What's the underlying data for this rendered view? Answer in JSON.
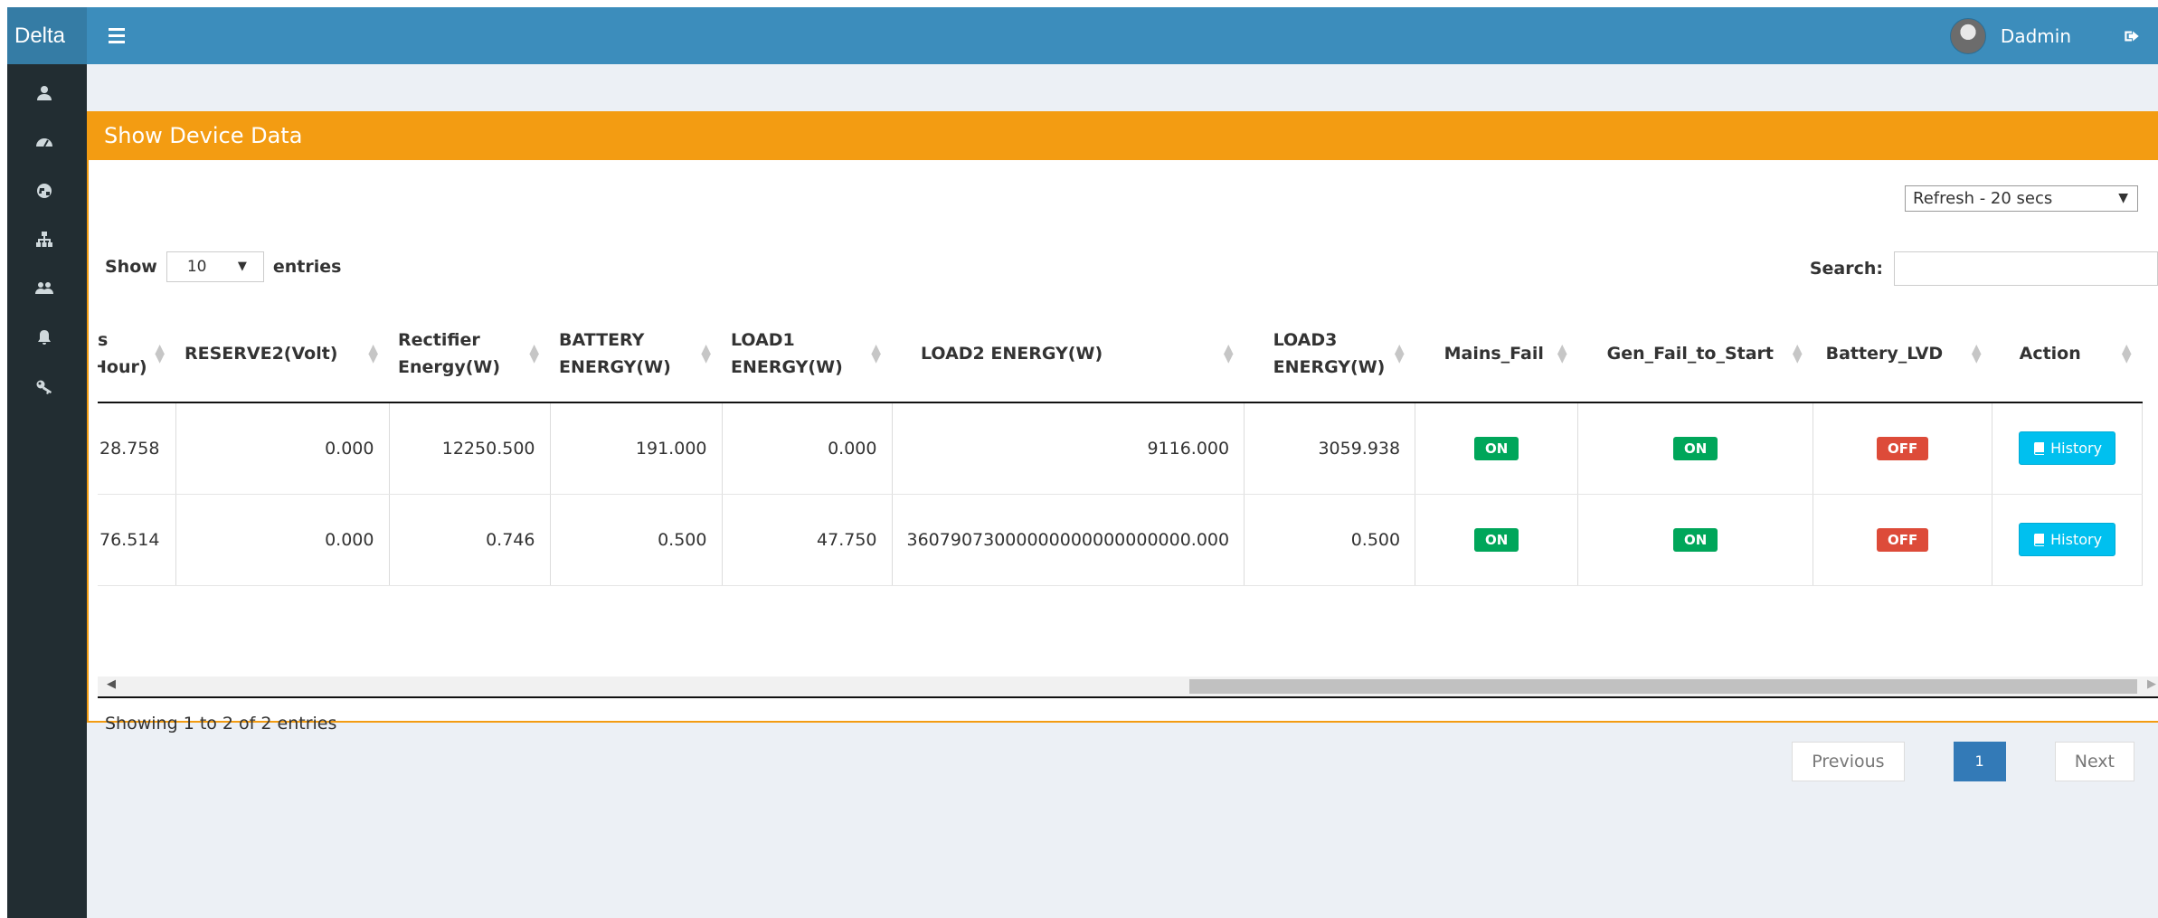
{
  "header": {
    "brand": "Delta",
    "username": "Dadmin"
  },
  "sidebar": {
    "icons": [
      "user-icon",
      "dashboard-icon",
      "globe-icon",
      "sitemap-icon",
      "users-icon",
      "bell-icon",
      "key-icon"
    ]
  },
  "box": {
    "title": "Show Device Data",
    "refresh": {
      "selected": "Refresh - 20 secs"
    },
    "length": {
      "show_label": "Show",
      "selected": "10",
      "entries_label": "entries"
    },
    "search": {
      "label": "Search:",
      "value": ""
    }
  },
  "table": {
    "columns": [
      {
        "line1": "s",
        "line2": "Hour)"
      },
      {
        "line1": "RESERVE2(Volt)",
        "line2": ""
      },
      {
        "line1": "Rectifier",
        "line2": "Energy(W)"
      },
      {
        "line1": "BATTERY",
        "line2": "ENERGY(W)"
      },
      {
        "line1": "LOAD1",
        "line2": "ENERGY(W)"
      },
      {
        "line1": "LOAD2 ENERGY(W)",
        "line2": ""
      },
      {
        "line1": "LOAD3",
        "line2": "ENERGY(W)"
      },
      {
        "line1": "Mains_Fail",
        "line2": ""
      },
      {
        "line1": "Gen_Fail_to_Start",
        "line2": ""
      },
      {
        "line1": "Battery_LVD",
        "line2": ""
      },
      {
        "line1": "Action",
        "line2": ""
      }
    ],
    "rows": [
      {
        "c0": "28.758",
        "reserve2": "0.000",
        "rectifier": "12250.500",
        "battery": "191.000",
        "load1": "0.000",
        "load2": "9116.000",
        "load3": "3059.938",
        "mains_fail": "ON",
        "gen_fail": "ON",
        "battery_lvd": "OFF",
        "action": "History"
      },
      {
        "c0": "76.514",
        "reserve2": "0.000",
        "rectifier": "0.746",
        "battery": "0.500",
        "load1": "47.750",
        "load2": "36079073000000000000000000.000",
        "load3": "0.500",
        "mains_fail": "ON",
        "gen_fail": "ON",
        "battery_lvd": "OFF",
        "action": "History"
      }
    ]
  },
  "info": "Showing 1 to 2 of 2 entries",
  "pagination": {
    "previous": "Previous",
    "current": "1",
    "next": "Next"
  },
  "colors": {
    "topbar": "#3c8dbc",
    "sidebar": "#222d32",
    "box_header": "#f39c12",
    "on": "#00a65a",
    "off": "#dd4b39",
    "history": "#00c0ef",
    "page_active": "#337ab7"
  }
}
